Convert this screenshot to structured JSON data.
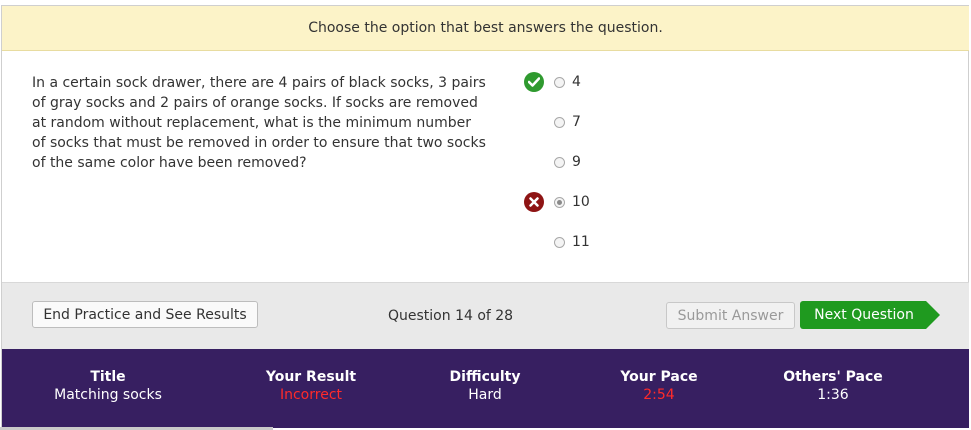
{
  "instruction": "Choose the option that best answers the question.",
  "question": "In a certain sock drawer, there are 4 pairs of black socks, 3 pairs of gray socks and 2 pairs of orange socks. If socks are removed at random without replacement, what is the minimum number of socks that must be removed in order to ensure that two socks of the same color have been removed?",
  "options": [
    {
      "label": "4",
      "state": "correct",
      "selected": false
    },
    {
      "label": "7",
      "state": "none",
      "selected": false
    },
    {
      "label": "9",
      "state": "none",
      "selected": false
    },
    {
      "label": "10",
      "state": "wrong",
      "selected": true
    },
    {
      "label": "11",
      "state": "none",
      "selected": false
    }
  ],
  "icons": {
    "correct": "check-circle-icon",
    "wrong": "x-circle-icon"
  },
  "colors": {
    "correct": "#2f9a2f",
    "wrong": "#8e1414",
    "next": "#1f9a1f",
    "stats_bg": "#371f61",
    "highlight_red": "#ff2a2a"
  },
  "footer": {
    "end_label": "End Practice and See Results",
    "counter": "Question 14 of 28",
    "submit_label": "Submit Answer",
    "next_label": "Next Question"
  },
  "stats": {
    "title_h": "Title",
    "title_v": "Matching socks",
    "result_h": "Your Result",
    "result_v": "Incorrect",
    "difficulty_h": "Difficulty",
    "difficulty_v": "Hard",
    "pace_h": "Your Pace",
    "pace_v": "2:54",
    "others_h": "Others' Pace",
    "others_v": "1:36"
  }
}
